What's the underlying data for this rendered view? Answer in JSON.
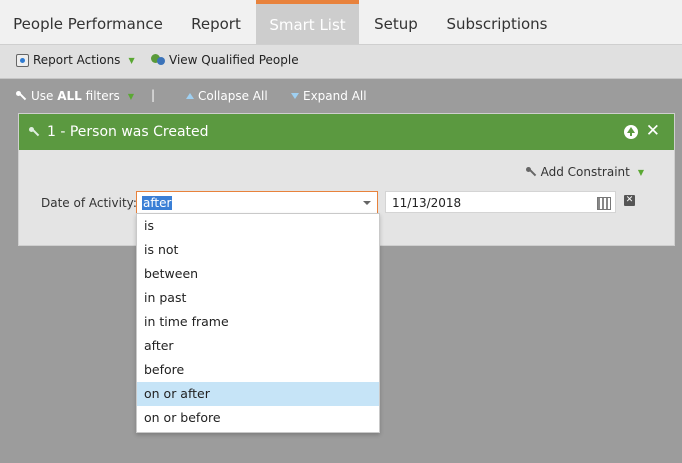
{
  "tabs": [
    {
      "label": "People Performance",
      "active": false
    },
    {
      "label": "Report",
      "active": false
    },
    {
      "label": "Smart List",
      "active": true
    },
    {
      "label": "Setup",
      "active": false
    },
    {
      "label": "Subscriptions",
      "active": false
    }
  ],
  "toolbar": {
    "report_actions": "Report Actions",
    "view_qualified": "View Qualified People"
  },
  "filterbar": {
    "use_prefix": "Use ",
    "use_bold": "ALL",
    "use_suffix": " filters",
    "separator": "|",
    "collapse_all": "Collapse All",
    "expand_all": "Expand All"
  },
  "filter": {
    "title": "1 - Person was Created",
    "add_constraint": "Add Constraint",
    "field_label": "Date of Activity:",
    "operator_value": "after",
    "date_value": "11/13/2018"
  },
  "dropdown": {
    "options": [
      "is",
      "is not",
      "between",
      "in past",
      "in time frame",
      "after",
      "before",
      "on or after",
      "on or before"
    ],
    "highlighted": "on or after"
  },
  "colors": {
    "accent_orange": "#e8823c",
    "header_green": "#5b9940",
    "highlight_blue": "#c6e4f7",
    "selection_blue": "#3a7fd6"
  }
}
